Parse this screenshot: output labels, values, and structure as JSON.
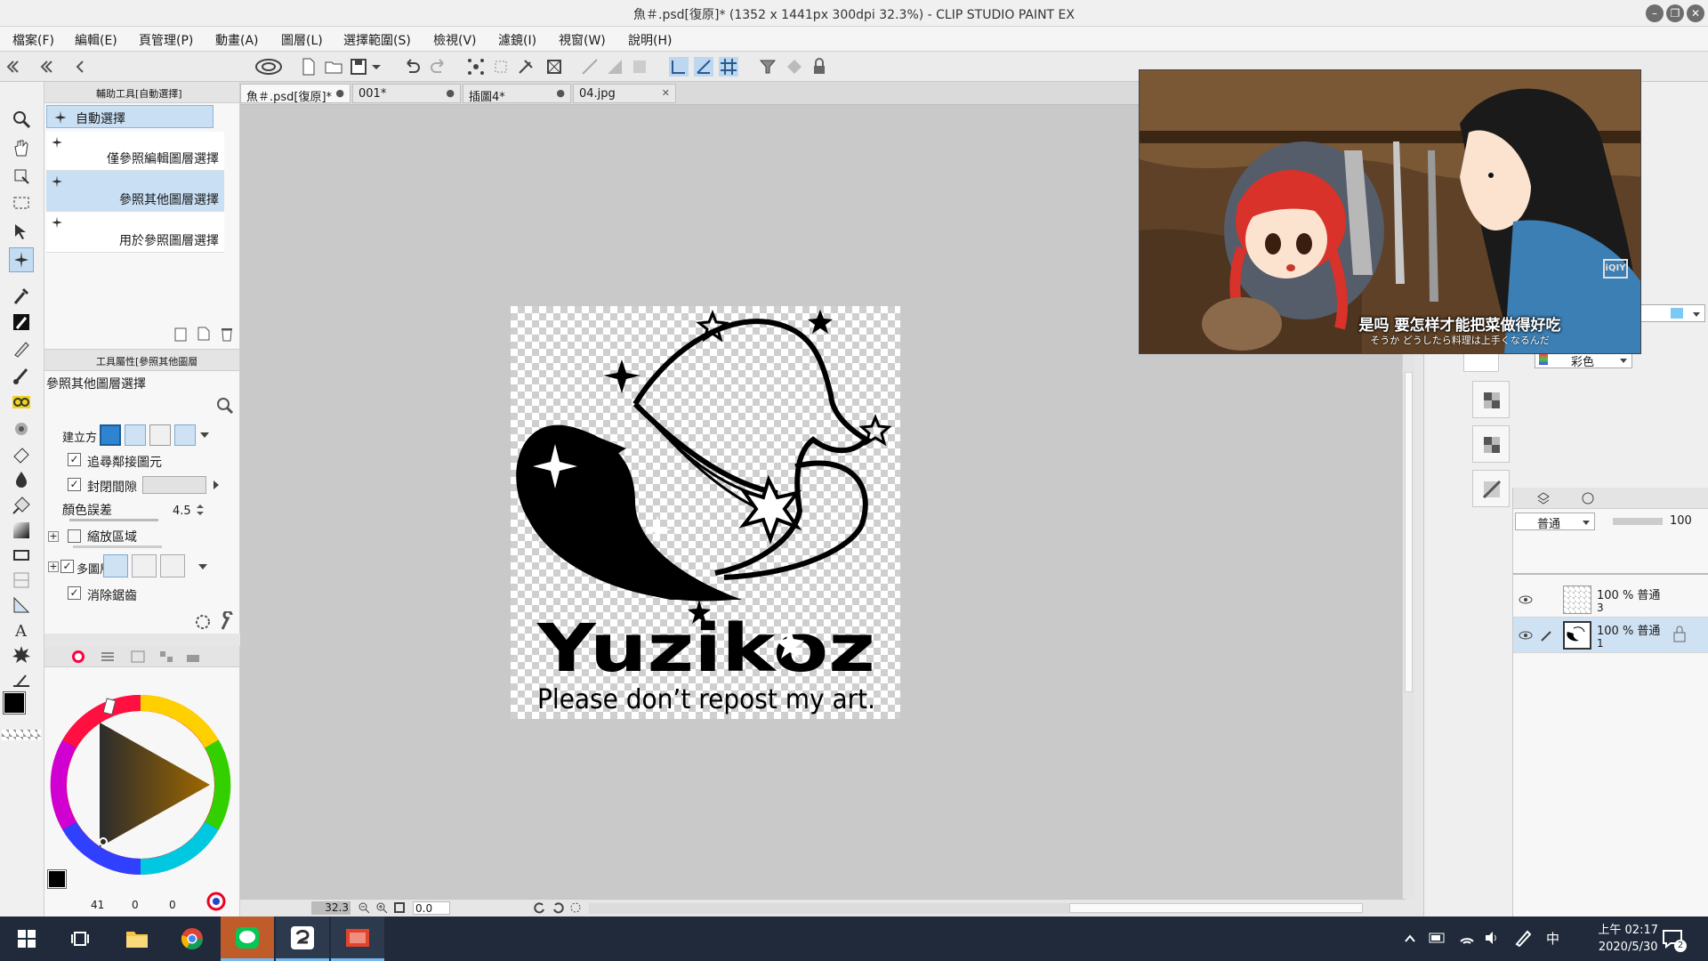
{
  "window": {
    "title": "魚＃.psd[復原]* (1352 x 1441px 300dpi 32.3%)  - CLIP STUDIO PAINT EX",
    "minimize": "–",
    "restore": "❐",
    "close": "✕"
  },
  "menu": [
    "檔案(F)",
    "編輯(E)",
    "頁管理(P)",
    "動畫(A)",
    "圖層(L)",
    "選擇範圍(S)",
    "檢視(V)",
    "濾鏡(I)",
    "視窗(W)",
    "說明(H)"
  ],
  "subtool": {
    "header": "輔助工具[自動選擇]",
    "group": "自動選擇",
    "items": [
      "僅參照編輯圖層選擇",
      "參照其他圖層選擇",
      "用於參照圖層選擇"
    ]
  },
  "toolprop": {
    "header": "工具屬性[參照其他圖層",
    "title": "參照其他圖層選擇",
    "create_label": "建立方",
    "follow_label": "追尋鄰接圖元",
    "close_gap_label": "封閉間隙",
    "color_margin_label": "顏色誤差",
    "color_margin_value": "4.5",
    "scale_area_label": "縮放區域",
    "multi_ref_label": "多圖層",
    "antialias_label": "消除鋸齒",
    "check": "✓"
  },
  "color": {
    "main": "#000000",
    "sub": "#3bc8f0",
    "values": [
      "41",
      "0",
      "0"
    ]
  },
  "tabs": [
    {
      "label": "魚＃.psd[復原]*",
      "close": "●"
    },
    {
      "label": "001*",
      "close": "●"
    },
    {
      "label": "插圖4*",
      "close": "●"
    },
    {
      "label": "04.jpg",
      "close": "✕"
    }
  ],
  "artwork": {
    "brand": "Yuzikoz",
    "notice": "Please don’t repost my art."
  },
  "canvas_status": {
    "zoom": "32.3",
    "angle": "0.0"
  },
  "video": {
    "subtitle_main": "是吗 要怎样才能把菜做得好吃",
    "subtitle_jp": "そうか どうしたら料理は上手くなるんだ",
    "watermark": "iQIY"
  },
  "right_panel": {
    "color_mode": "彩色"
  },
  "layers": {
    "blend_mode": "普通",
    "opacity": "100",
    "items": [
      {
        "name": "3",
        "info": "100 % 普通"
      },
      {
        "name": "1",
        "info": "100 % 普通"
      }
    ]
  },
  "taskbar": {
    "time": "上午 02:17",
    "date": "2020/5/30",
    "ime": "中",
    "notifications": "2"
  }
}
